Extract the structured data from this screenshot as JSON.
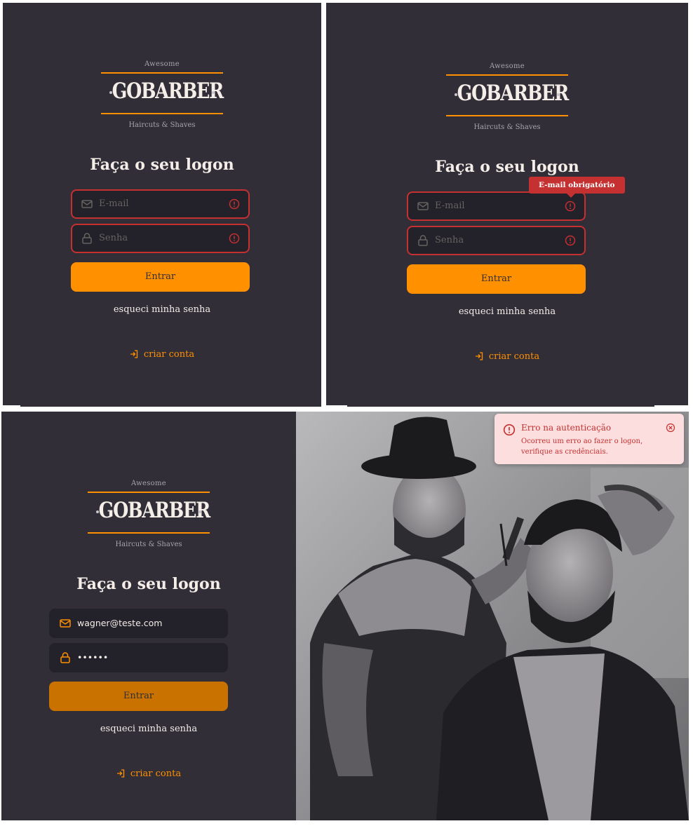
{
  "logo": {
    "top": "Awesome",
    "word": "GOBARBER",
    "bottom": "Haircuts & Shaves"
  },
  "screens": [
    {
      "title": "Faça o seu logon",
      "email_placeholder": "E-mail",
      "password_placeholder": "Senha",
      "submit_label": "Entrar",
      "forgot_label": "esqueci minha senha",
      "create_label": "criar conta"
    },
    {
      "title": "Faça o seu logon",
      "email_placeholder": "E-mail",
      "password_placeholder": "Senha",
      "tooltip": "E-mail obrigatório",
      "submit_label": "Entrar",
      "forgot_label": "esqueci minha senha",
      "create_label": "criar conta"
    },
    {
      "title": "Faça o seu logon",
      "email_value": "wagner@teste.com",
      "password_value": "••••••",
      "submit_label": "Entrar",
      "forgot_label": "esqueci minha senha",
      "create_label": "criar conta"
    }
  ],
  "toast": {
    "title": "Erro na autenticação",
    "message": "Ocorreu um erro ao fazer o logon, verifique as credênciais."
  },
  "colors": {
    "background": "#312e38",
    "input": "#232129",
    "accent": "#ff9000",
    "error": "#c53030",
    "text": "#f4ede8",
    "placeholder": "#666360",
    "toast_bg": "#fddede"
  }
}
